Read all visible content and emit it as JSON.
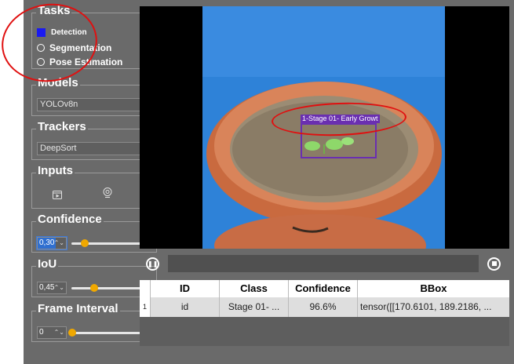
{
  "tasks": {
    "title": "Tasks",
    "options": [
      {
        "label": "Detection",
        "selected": true
      },
      {
        "label": "Segmentation",
        "selected": false
      },
      {
        "label": "Pose Estimation",
        "selected": false
      }
    ]
  },
  "models": {
    "title": "Models",
    "selected": "YOLOv8n"
  },
  "trackers": {
    "title": "Trackers",
    "selected": "DeepSort"
  },
  "inputs": {
    "title": "Inputs",
    "icons": [
      "video-file-icon",
      "webcam-icon"
    ]
  },
  "confidence": {
    "title": "Confidence",
    "value": "0,30",
    "level": 0.3
  },
  "iou": {
    "title": "IoU",
    "value": "0,45",
    "level": 0.45
  },
  "frame_interval": {
    "title": "Frame Interval",
    "value": "0",
    "level": 0
  },
  "video": {
    "detection_label": "1-Stage 01- Early Growt"
  },
  "controls": {
    "play_icon": "pause-icon",
    "stop_icon": "stop-icon"
  },
  "table": {
    "headers": [
      "ID",
      "Class",
      "Confidence",
      "BBox"
    ],
    "rows": [
      {
        "index": "1",
        "id": "id",
        "class": "Stage 01- ...",
        "confidence": "96.6%",
        "bbox": "tensor([[170.6101, 189.2186, ..."
      }
    ]
  },
  "colors": {
    "panel": "#6a6a6a",
    "accent": "#f0a800",
    "selected": "#1a1af0",
    "annotation": "#e01010",
    "bbox": "#6a2fb0"
  }
}
